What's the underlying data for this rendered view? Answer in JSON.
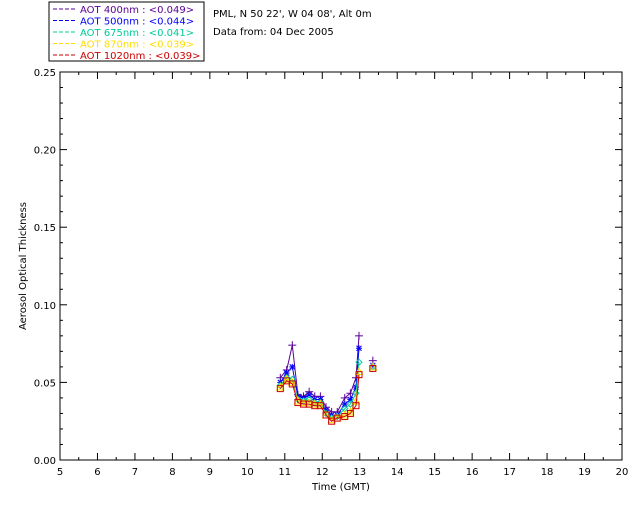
{
  "info": {
    "site": "PML, N 50 22', W 04 08', Alt 0m",
    "date": "Data from: 04 Dec 2005"
  },
  "chart_data": {
    "type": "line",
    "xlabel": "Time (GMT)",
    "ylabel": "Aerosol Optical Thickness",
    "xlim": [
      5,
      20
    ],
    "ylim": [
      0,
      0.25
    ],
    "xticks": [
      "5",
      "6",
      "7",
      "8",
      "9",
      "10",
      "11",
      "12",
      "13",
      "14",
      "15",
      "16",
      "17",
      "18",
      "19",
      "20"
    ],
    "yticks": [
      "0.00",
      "0.05",
      "0.10",
      "0.15",
      "0.20",
      "0.25"
    ],
    "grid": false,
    "legend_position": "top-left, above plot",
    "x": [
      10.88,
      11.05,
      11.2,
      11.35,
      11.5,
      11.65,
      11.8,
      11.95,
      12.1,
      12.25,
      12.4,
      12.6,
      12.75,
      12.9,
      12.98,
      13.35
    ],
    "series": [
      {
        "name": "AOT  400nm : <0.049>",
        "color": "#5a0096",
        "marker": "plus",
        "values": [
          0.053,
          0.058,
          0.074,
          0.042,
          0.041,
          0.044,
          0.041,
          0.041,
          0.034,
          0.031,
          0.031,
          0.04,
          0.043,
          0.053,
          0.08,
          0.064
        ]
      },
      {
        "name": "AOT  500nm : <0.044>",
        "color": "#0000ff",
        "marker": "asterisk",
        "values": [
          0.05,
          0.056,
          0.06,
          0.041,
          0.04,
          0.042,
          0.039,
          0.039,
          0.032,
          0.029,
          0.029,
          0.036,
          0.039,
          0.047,
          0.072,
          0.061
        ]
      },
      {
        "name": "AOT  675nm : <0.041>",
        "color": "#00cc99",
        "marker": "diamond",
        "values": [
          0.048,
          0.053,
          0.052,
          0.039,
          0.038,
          0.039,
          0.037,
          0.037,
          0.03,
          0.027,
          0.028,
          0.033,
          0.036,
          0.043,
          0.063,
          0.06
        ]
      },
      {
        "name": "AOT  870nm : <0.039>",
        "color": "#ffdd00",
        "marker": "triangle",
        "values": [
          0.047,
          0.052,
          0.05,
          0.038,
          0.037,
          0.037,
          0.036,
          0.036,
          0.029,
          0.026,
          0.027,
          0.029,
          0.031,
          0.038,
          0.057,
          0.06
        ]
      },
      {
        "name": "AOT 1020nm : <0.039>",
        "color": "#cc0000",
        "marker": "square",
        "values": [
          0.046,
          0.051,
          0.049,
          0.037,
          0.036,
          0.036,
          0.035,
          0.035,
          0.029,
          0.025,
          0.027,
          0.028,
          0.03,
          0.035,
          0.055,
          0.059
        ]
      }
    ]
  }
}
